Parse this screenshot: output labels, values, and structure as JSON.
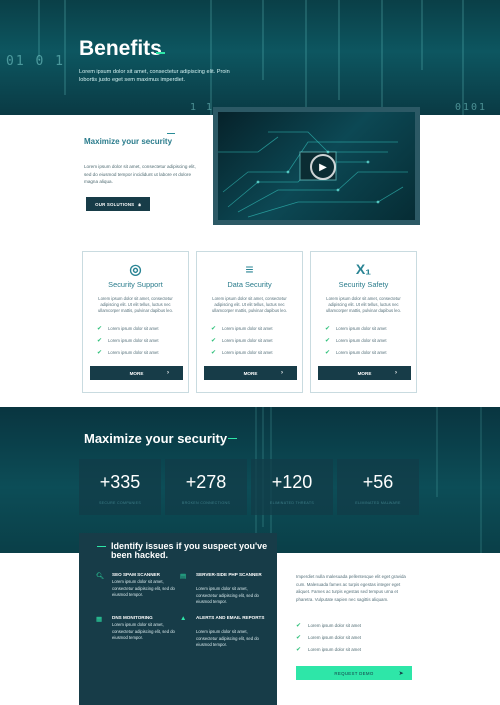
{
  "hero": {
    "title": "Benefits",
    "subtitle": "Lorem ipsum dolor sit amet, consectetur adipiscing elit. Proin lobortis justo eget sem maximus imperdiet.",
    "binary_left": "01 0 1",
    "binary_mid": "1 1",
    "binary_right": "0101"
  },
  "intro": {
    "title": "Maximize your security",
    "text": "Lorem ipsum dolor sit amet, consectetur adipiscing elit, sed do eiusmod tempor incididunt ut labore et dolore magna aliqua.",
    "button_label": "OUR SOLUTIONS"
  },
  "cards": [
    {
      "icon": "lifebuoy-icon",
      "glyph": "◎",
      "title": "Security Support",
      "description": "Lorem ipsum dolor sit amet, consectetur adipiscing elit. Ut elit tellus, luctus nec ullamcorper mattis, pulvinar dapibus leo.",
      "items": [
        "Lorem ipsum dolor sit amet",
        "Lorem ipsum dolor sit amet",
        "Lorem ipsum dolor sit amet"
      ],
      "button_label": "MORE"
    },
    {
      "icon": "stack-overflow-icon",
      "glyph": "≡",
      "title": "Data Security",
      "description": "Lorem ipsum dolor sit amet, consectetur adipiscing elit. Ut elit tellus, luctus nec ullamcorper mattis, pulvinar dapibus leo.",
      "items": [
        "Lorem ipsum dolor sit amet",
        "Lorem ipsum dolor sit amet",
        "Lorem ipsum dolor sit amet"
      ],
      "button_label": "MORE"
    },
    {
      "icon": "subscript-icon",
      "glyph": "X₁",
      "title": "Security Safety",
      "description": "Lorem ipsum dolor sit amet, consectetur adipiscing elit. Ut elit tellus, luctus nec ullamcorper mattis, pulvinar dapibus leo.",
      "items": [
        "Lorem ipsum dolor sit amet",
        "Lorem ipsum dolor sit amet",
        "Lorem ipsum dolor sit amet"
      ],
      "button_label": "MORE"
    }
  ],
  "stats": {
    "title": "Maximize your security",
    "items": [
      {
        "value": "+335",
        "label": "SECURE COMPANIES"
      },
      {
        "value": "+278",
        "label": "BROKEN CONNECTIONS"
      },
      {
        "value": "+120",
        "label": "ELIMINATED THREATS"
      },
      {
        "value": "+56",
        "label": "ELIMINATED MALWARE"
      }
    ]
  },
  "identify": {
    "title": "Identify issues if you suspect you've been hacked.",
    "features": [
      {
        "icon": "search-icon",
        "glyph": "🔍︎",
        "title": "SEO SPAM SCANNER",
        "text": "Lorem ipsum dolor sit amet, consectetur adipiscing elit, sed do eiusmod tempor."
      },
      {
        "icon": "server-icon",
        "glyph": "▤",
        "title": "SERVER-SIDE PHP SCANNER",
        "text": "Lorem ipsum dolor sit amet, consectetur adipiscing elit, sed do eiusmod tempor."
      },
      {
        "icon": "dns-grid-icon",
        "glyph": "▦",
        "title": "DNS MONITORING",
        "text": "Lorem ipsum dolor sit amet, consectetur adipiscing elit, sed do eiusmod tempor."
      },
      {
        "icon": "warning-icon",
        "glyph": "▲",
        "title": "ALERTS AND EMAIL REPORTS",
        "text": "Lorem ipsum dolor sit amet, consectetur adipiscing elit, sed do eiusmod tempor."
      }
    ]
  },
  "demo": {
    "text": "Imperdiet nulla malesuada pellentesque elit eget gravida cum. Malesuada fames ac turpis egestas integer eget aliquet. Fames ac turpis egestas sed tempus urna et pharetra. Vulputate sapien nec sagittis aliquam.",
    "items": [
      "Lorem ipsum dolor sit amet",
      "Lorem ipsum dolor sit amet",
      "Lorem ipsum dolor sit amet"
    ],
    "button_label": "REQUEST DEMO"
  },
  "colors": {
    "dark_teal": "#173c48",
    "accent_green": "#2ee6a8",
    "title_teal": "#2a7c8c"
  }
}
